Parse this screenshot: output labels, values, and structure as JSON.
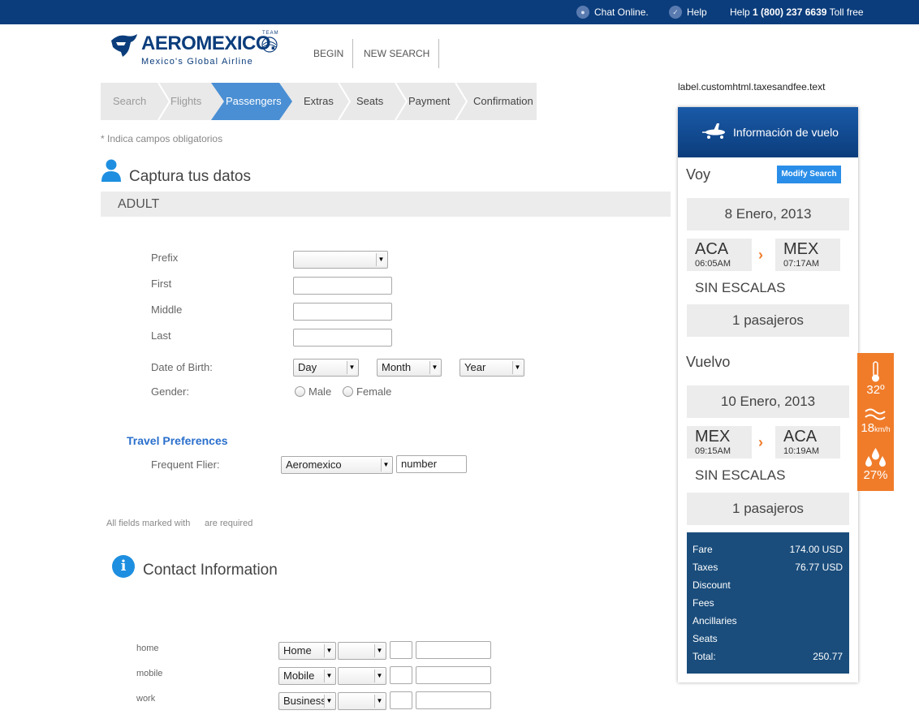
{
  "topbar": {
    "chat": "Chat Online.",
    "help": "Help",
    "phone_prefix": "Help",
    "phone_number": "1 (800) 237 6639",
    "phone_suffix": "Toll free"
  },
  "logo": {
    "brand": "AEROMEXICO.",
    "tagline": "Mexico's Global Airline",
    "team": "TEAM"
  },
  "header_nav": {
    "begin": "BEGIN",
    "new_search": "NEW SEARCH"
  },
  "steps": [
    "Search",
    "Flights",
    "Passengers",
    "Extras",
    "Seats",
    "Payment",
    "Confirmation"
  ],
  "required_note": "* Indica campos obligatorios",
  "passenger_section": {
    "title": "Captura tus datos",
    "passenger_type": "ADULT",
    "labels": {
      "prefix": "Prefix",
      "first": "First",
      "middle": "Middle",
      "last": "Last",
      "dob": "Date of Birth:",
      "gender": "Gender:"
    },
    "dob_selects": {
      "day": "Day",
      "month": "Month",
      "year": "Year"
    },
    "gender_options": {
      "male": "Male",
      "female": "Female"
    }
  },
  "travel_preferences": {
    "title": "Travel Preferences",
    "frequent_flier_label": "Frequent Flier:",
    "frequent_flier_program": "Aeromexico",
    "frequent_flier_number": "number"
  },
  "all_fields_note": {
    "part1": "All fields marked with",
    "part2": "are required"
  },
  "contact_section": {
    "title": "Contact Information",
    "rows": [
      {
        "label": "home",
        "type": "Home"
      },
      {
        "label": "mobile",
        "type": "Mobile"
      },
      {
        "label": "work",
        "type": "Business"
      }
    ]
  },
  "taxes_label": "label.customhtml.taxesandfee.text",
  "flight_panel": {
    "title": "Información de vuelo",
    "outbound": {
      "heading": "Voy",
      "modify_button": "Modify Search",
      "date": "8 Enero, 2013",
      "origin": {
        "code": "ACA",
        "time": "06:05AM"
      },
      "destination": {
        "code": "MEX",
        "time": "07:17AM"
      },
      "stops": "SIN ESCALAS",
      "passengers": "1 pasajeros"
    },
    "return": {
      "heading": "Vuelvo",
      "date": "10 Enero, 2013",
      "origin": {
        "code": "MEX",
        "time": "09:15AM"
      },
      "destination": {
        "code": "ACA",
        "time": "10:19AM"
      },
      "stops": "SIN ESCALAS",
      "passengers": "1 pasajeros"
    },
    "fare": [
      {
        "label": "Fare",
        "value": "174.00 USD"
      },
      {
        "label": "Taxes",
        "value": "76.77 USD"
      },
      {
        "label": "Discount",
        "value": ""
      },
      {
        "label": "Fees",
        "value": ""
      },
      {
        "label": "Ancillaries",
        "value": ""
      },
      {
        "label": "Seats",
        "value": ""
      },
      {
        "label": "Total:",
        "value": "250.77"
      }
    ]
  },
  "weather": {
    "temperature": "32º",
    "wind_value": "18",
    "wind_unit": "km/h",
    "humidity": "27%",
    "accent_color": "#f07c2a"
  },
  "colors": {
    "brand_blue": "#0b3d7c",
    "active_step": "#4a8fd4",
    "fare_box": "#1a4d7c"
  }
}
